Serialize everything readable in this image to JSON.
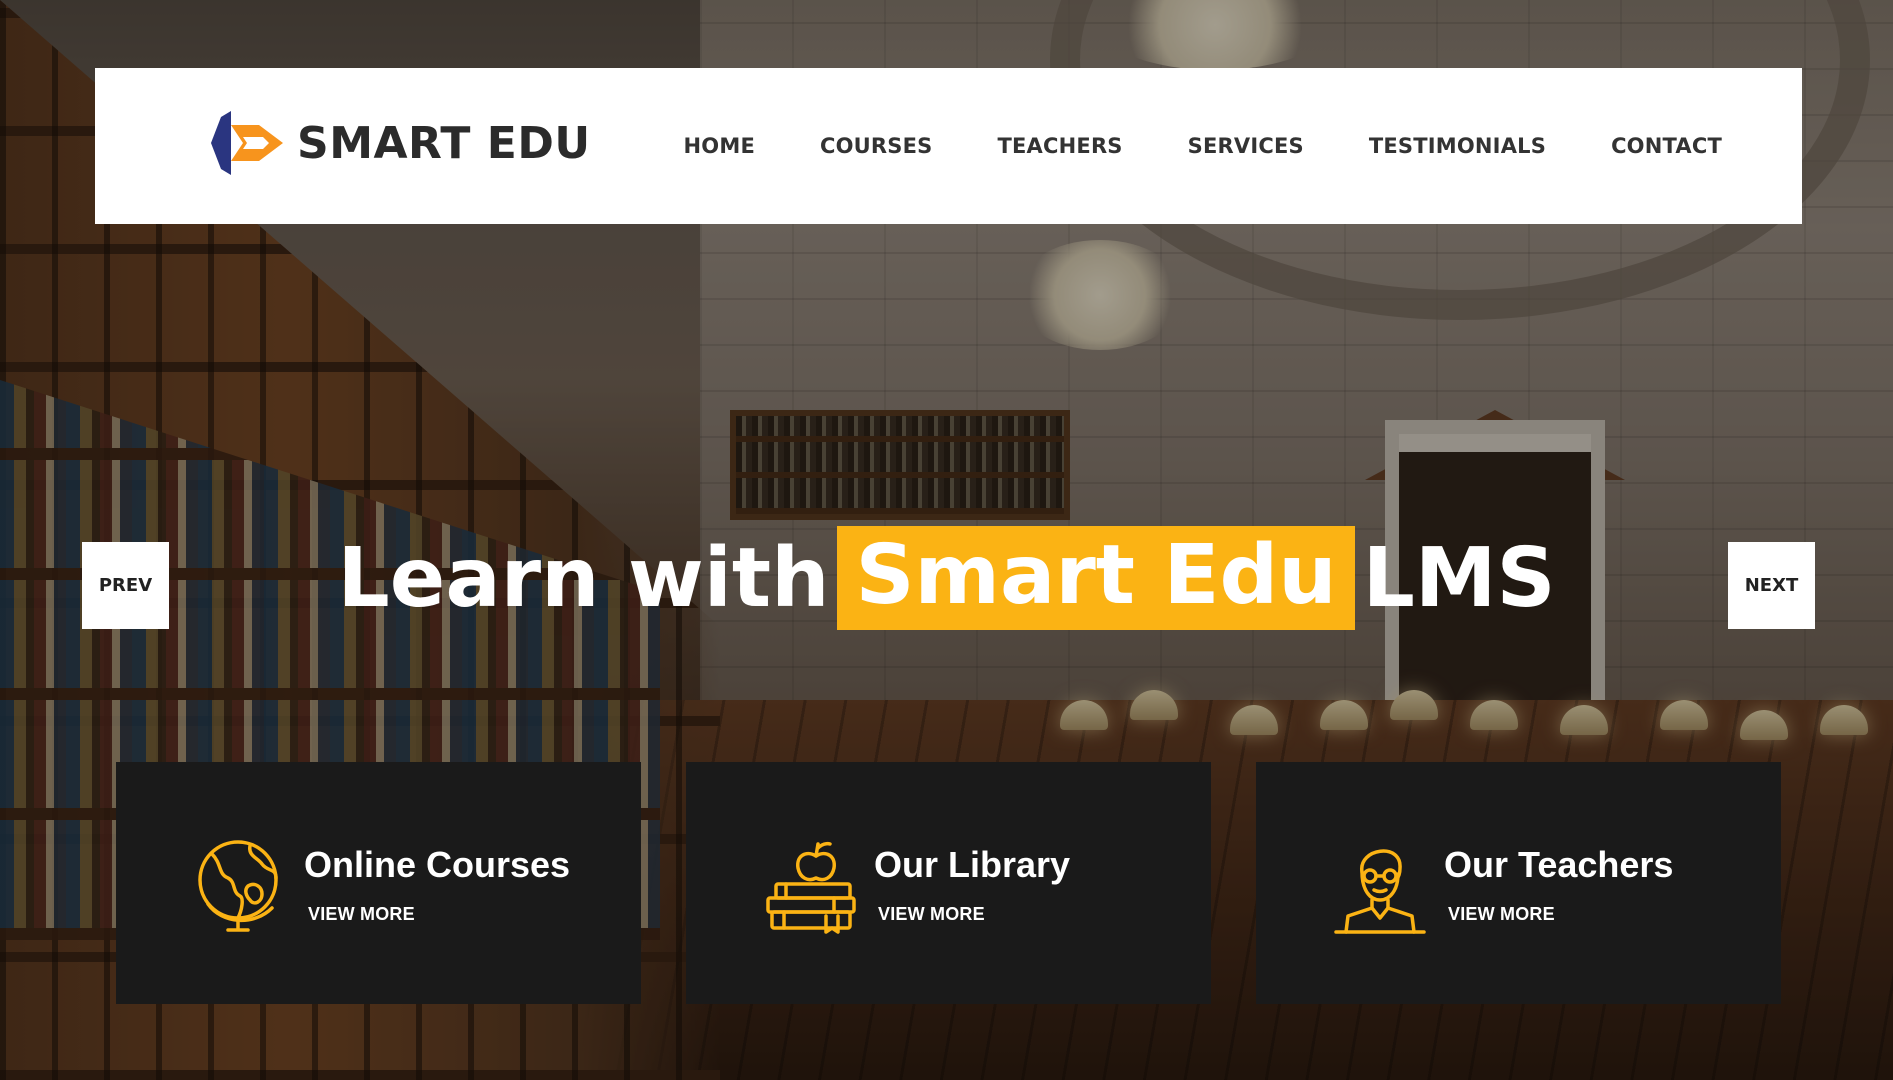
{
  "brand": {
    "name": "SMART EDU",
    "logo_icon": "smart-edu-logo-mark",
    "accent_color": "#fbb314",
    "logo_colors": [
      "#2a3580",
      "#f7941d"
    ]
  },
  "nav": {
    "items": [
      {
        "label": "HOME"
      },
      {
        "label": "COURSES"
      },
      {
        "label": "TEACHERS"
      },
      {
        "label": "SERVICES"
      },
      {
        "label": "TESTIMONIALS"
      },
      {
        "label": "CONTACT"
      }
    ]
  },
  "hero": {
    "title_before": "Learn with",
    "title_highlight": "Smart Edu",
    "title_after": "LMS",
    "prev_label": "PREV",
    "next_label": "NEXT"
  },
  "features": [
    {
      "title": "Online Courses",
      "link": "VIEW MORE",
      "icon": "globe-icon"
    },
    {
      "title": "Our Library",
      "link": "VIEW MORE",
      "icon": "books-apple-icon"
    },
    {
      "title": "Our Teachers",
      "link": "VIEW MORE",
      "icon": "teacher-icon"
    }
  ],
  "colors": {
    "header_bg": "#ffffff",
    "card_bg": "#1a1a1a",
    "nav_text": "#333333"
  }
}
